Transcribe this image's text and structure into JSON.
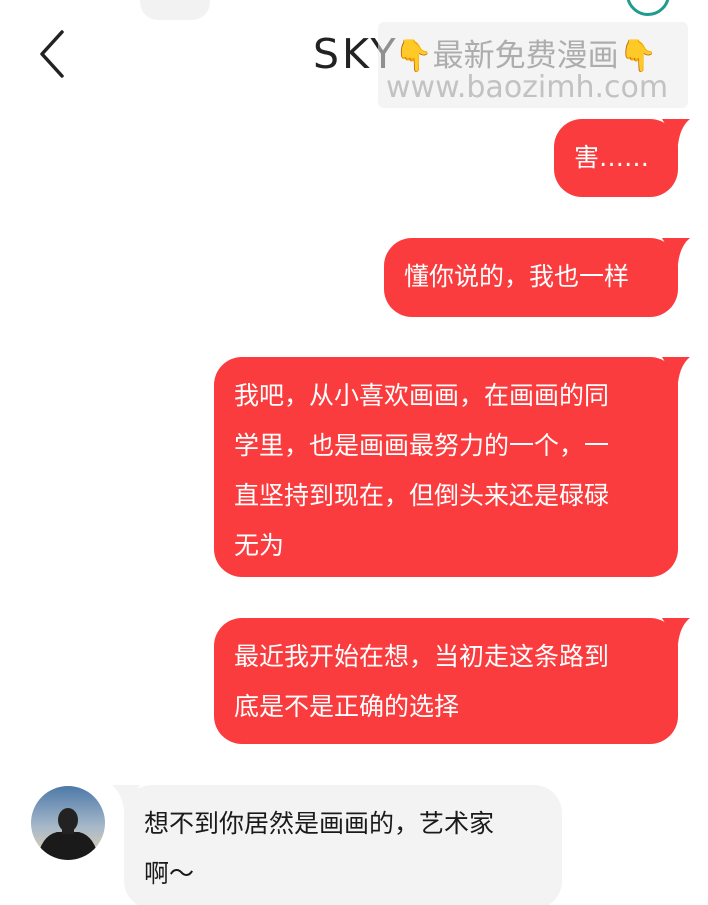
{
  "header": {
    "title": "SKY",
    "back_icon": "chevron-left-icon"
  },
  "watermark": {
    "line1": "最新免费漫画",
    "line2": "www.baozimh.com",
    "icon": "pointing-down-hand-icon"
  },
  "messages": [
    {
      "side": "outgoing",
      "text": "害……"
    },
    {
      "side": "outgoing",
      "text": "懂你说的，我也一样"
    },
    {
      "side": "outgoing",
      "text": "我吧，从小喜欢画画，在画画的同\n学里，也是画画最努力的一个，一\n直坚持到现在，但倒头来还是碌碌\n无为"
    },
    {
      "side": "outgoing",
      "text": "最近我开始在想，当初走这条路到\n底是不是正确的选择"
    },
    {
      "side": "incoming",
      "text": "想不到你居然是画画的，艺术家\n啊～"
    }
  ],
  "colors": {
    "outgoing_bubble": "#fb3c3e",
    "incoming_bubble": "#f3f3f3",
    "watermark_finger": "#f0b623"
  }
}
